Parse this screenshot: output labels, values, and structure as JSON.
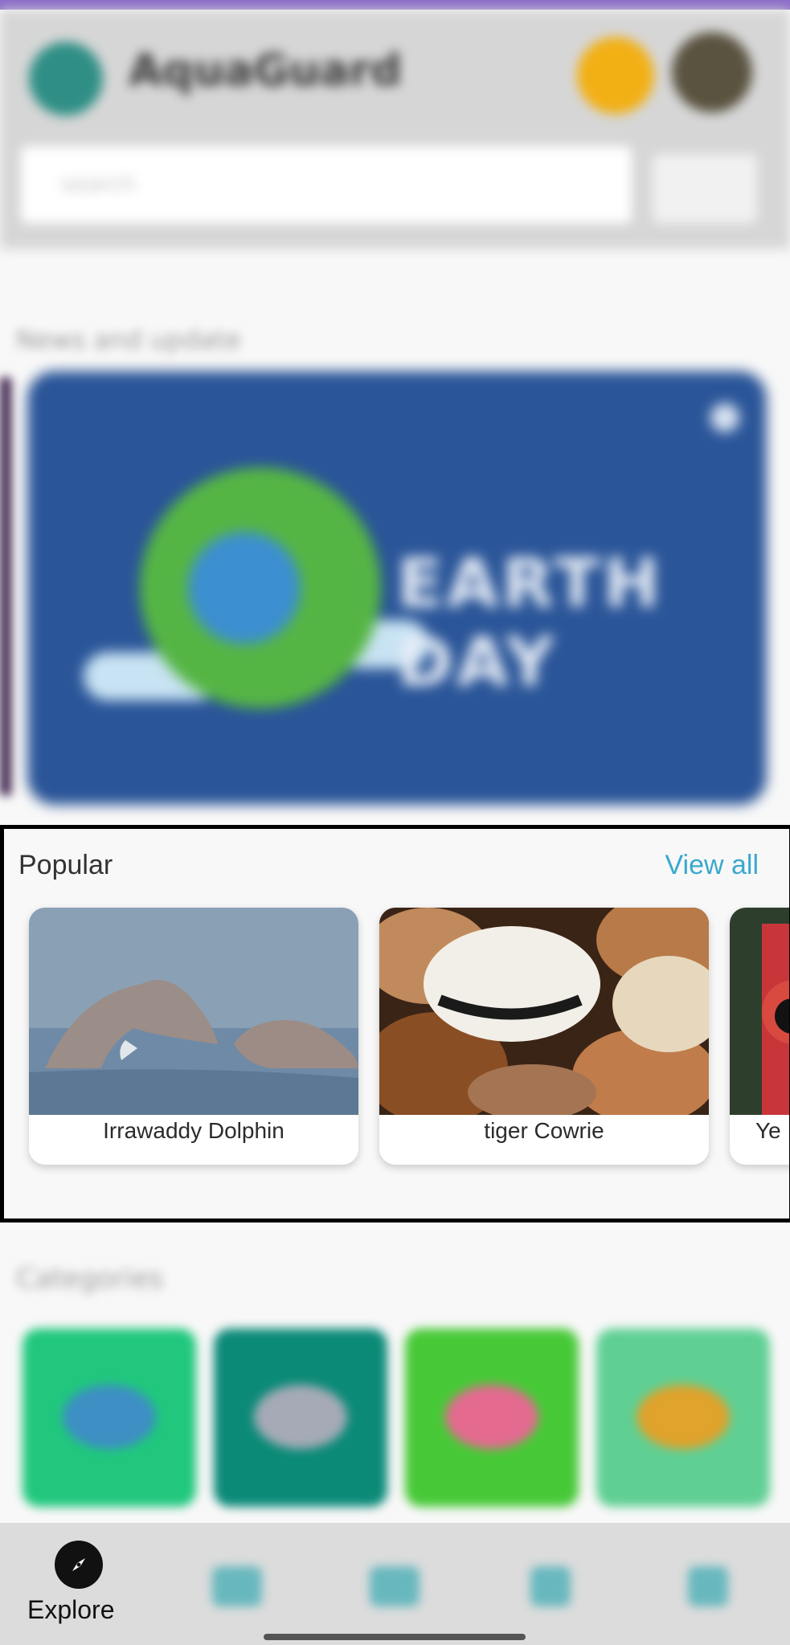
{
  "app": {
    "title": "AquaGuard",
    "accent_color": "#8c6cc9",
    "link_color": "#39a9cf"
  },
  "search": {
    "placeholder": "search"
  },
  "news": {
    "title": "News and update",
    "banner_text": "EARTH DAY"
  },
  "popular": {
    "title": "Popular",
    "view_all": "View all",
    "items": [
      {
        "name": "Irrawaddy Dolphin",
        "image": "dolphin-photo"
      },
      {
        "name": "tiger Cowrie",
        "image": "cowrie-shell-photo"
      },
      {
        "name": "Ye",
        "image": "red-fish-photo"
      }
    ]
  },
  "categories": {
    "title": "Categories",
    "tiles": [
      {
        "icon": "dolphin-icon",
        "color": "#20c77d"
      },
      {
        "icon": "fish-icon",
        "color": "#0b8a78"
      },
      {
        "icon": "crab-icon",
        "color": "#47c937"
      },
      {
        "icon": "shell-icon",
        "color": "#5fcf93"
      }
    ]
  },
  "bottom_nav": {
    "explore": "Explore",
    "items": [
      "explore-icon",
      "chat-icon",
      "shop-icon",
      "book-icon",
      "profile-icon"
    ]
  }
}
